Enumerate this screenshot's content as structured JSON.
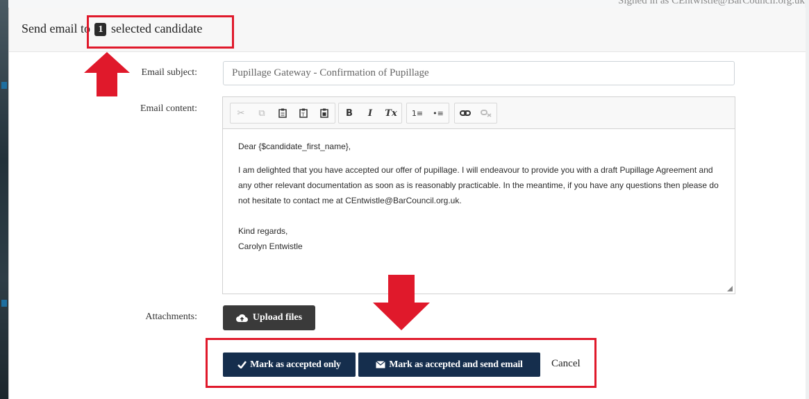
{
  "background": {
    "top_text": "Signed in as CEntwistle@BarCouncil.org.uk"
  },
  "modal": {
    "title_prefix": "Send email to",
    "selected_count": "1",
    "title_suffix": "selected candidate"
  },
  "form": {
    "subject_label": "Email subject:",
    "subject_value": "Pupillage Gateway - Confirmation of Pupillage",
    "content_label": "Email content:",
    "attachments_label": "Attachments:",
    "upload_label": "Upload files"
  },
  "toolbar": {
    "cut": "✂",
    "copy": "⧉",
    "paste": "📋",
    "bold": "B",
    "italic": "I",
    "remove_format": "Tx",
    "numbered_list": "1≡",
    "bulleted_list": "•≡",
    "link": "🔗",
    "unlink": "⛓"
  },
  "email_body": {
    "greeting": "Dear {$candidate_first_name},",
    "paragraph": "I am delighted that you have accepted our offer of pupillage. I will endeavour to provide you with a draft Pupillage Agreement and any other relevant documentation as soon as is reasonably practicable. In the meantime, if you have any questions then please do not hesitate to contact me at CEntwistle@BarCouncil.org.uk.",
    "signoff": "Kind regards,",
    "signature": "Carolyn Entwistle"
  },
  "actions": {
    "accept_only": "Mark as accepted only",
    "accept_and_send": "Mark as accepted and send email",
    "cancel": "Cancel"
  },
  "colors": {
    "primary": "#152e4d",
    "annotation_red": "#e0192b"
  }
}
